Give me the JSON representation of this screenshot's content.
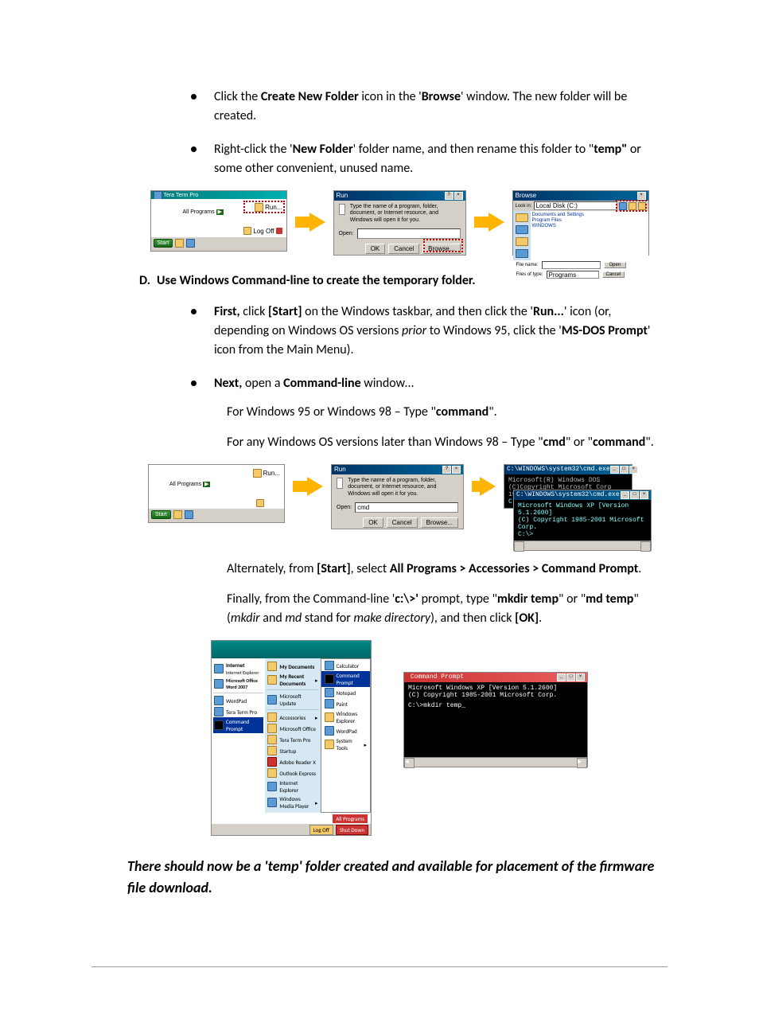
{
  "bullets_c": [
    {
      "pre": "Click the ",
      "b1": "Create New Folder",
      "mid1": " icon in the '",
      "b2": "Browse",
      "mid2": "' window. The new folder will be created."
    },
    {
      "pre": "Right-click the '",
      "b1": "New Folder",
      "mid1": "' folder name, and then rename this folder to \"",
      "b2": "temp\"",
      "mid2": " or some other convenient, unused name."
    }
  ],
  "section_d": {
    "letter": "D.",
    "title": "Use Windows Command-line to create the temporary folder."
  },
  "bullets_d": [
    {
      "first_b": "First,",
      "mid1": " click ",
      "b2": "[Start]",
      "mid2": " on the Windows taskbar, and then click the '",
      "b3": "Run...",
      "mid3": "' icon (or, depending on Windows OS versions ",
      "i1": "prior",
      "mid4": " to Windows 95, click the '",
      "b4": "MS-DOS Prompt",
      "mid5": "' icon from the Main Menu)."
    },
    {
      "first_b": "Next,",
      "mid1": " open a ",
      "b2": "Command-line",
      "mid2": " window…"
    }
  ],
  "indent": {
    "line1a": "For Windows 95 or Windows 98 – Type \"",
    "line1b": "command",
    "line1c": "\".",
    "line2a": "For any Windows OS versions later than Windows 98 – Type \"",
    "line2b": "cmd",
    "line2c": "\" or \"",
    "line2d": "command",
    "line2e": "\".",
    "alt1": "Alternately, from ",
    "alt_b1": "[Start]",
    "alt2": ", select ",
    "alt_b2": "All Programs > Accessories > Command Prompt",
    "alt3": ".",
    "fin1": "Finally, from the Command-line '",
    "fin_b1": "c:\\>'",
    "fin2": " prompt, type \"",
    "fin_b2": "mkdir temp",
    "fin3": "\" or \"",
    "fin_b3": "md temp",
    "fin4": "\" (",
    "fin_i1": "mkdir",
    "fin5": " and ",
    "fin_i2": "md",
    "fin6": " stand for ",
    "fin_i3": "make directory",
    "fin7": "), and then click ",
    "fin_b4": "[OK]",
    "fin8": "."
  },
  "final_note": "There should now be a 'temp' folder created and available for placement of the firmware file download.",
  "fig1": {
    "start": {
      "titleicon": "Tera Term Pro",
      "all_programs": "All Programs",
      "run": "Run...",
      "logoff": "Log Off",
      "start": "Start"
    },
    "run": {
      "title": "Run",
      "desc": "Type the name of a program, folder, document, or Internet resource, and Windows will open it for you.",
      "open": "Open:",
      "ok": "OK",
      "cancel": "Cancel",
      "browse": "Browse...",
      "value": ""
    },
    "browse": {
      "title": "Browse",
      "lookin": "Look in:",
      "drive": "Local Disk (C:)",
      "f1": "Documents and Settings",
      "f2": "Program Files",
      "f3": "WINDOWS",
      "filename_lbl": "File name:",
      "filetype_lbl": "Files of type:",
      "type": "Programs",
      "open": "Open",
      "cancel": "Cancel"
    }
  },
  "fig2": {
    "start": {
      "all_programs": "All Programs",
      "run": "Run...",
      "start": "Start"
    },
    "run": {
      "title": "Run",
      "desc": "Type the name of a program, folder, document, or Internet resource, and Windows will open it for you.",
      "open": "Open:",
      "value": "cmd",
      "ok": "OK",
      "cancel": "Cancel",
      "browse": "Browse..."
    },
    "cmd1": {
      "title": "C:\\WINDOWS\\system32\\cmd.exe",
      "l1": "Microsoft(R) Windows DOS",
      "l2": "(C)Copyright Microsoft Corp 1990-2001.",
      "l3": "C:\\>"
    },
    "cmd2": {
      "title": "C:\\WINDOWS\\system32\\cmd.exe",
      "l1": "Microsoft Windows XP [Version 5.1.2600]",
      "l2": "(C) Copyright 1985-2001 Microsoft Corp.",
      "l3": "C:\\>"
    }
  },
  "fig3": {
    "menu": {
      "internet": "Internet",
      "ie": "Internet Explorer",
      "word": "Microsoft Office Word 2007",
      "mydocs": "My Documents",
      "recent": "My Recent Documents",
      "update": "Microsoft Update",
      "wordpad": "WordPad",
      "ttp": "Tera Term Pro",
      "cp": "Command Prompt",
      "acc": "Accessories",
      "msoffice": "Microsoft Office",
      "teraterm": "Tera Term Pro",
      "startup": "Startup",
      "adober": "Adobe Reader X",
      "outlook": "Outlook Express",
      "iexp": "Internet Explorer",
      "wmp": "Windows Media Player",
      "calc": "Calculator",
      "cmdp": "Command Prompt",
      "notepad": "Notepad",
      "paint": "Paint",
      "winexp": "Windows Explorer",
      "wpad": "WordPad",
      "systools": "System Tools",
      "allprog": "All Programs",
      "logoff": "Log Off",
      "shutdown": "Shut Down"
    },
    "cmd": {
      "title": "Command Prompt",
      "l1": "Microsoft Windows XP [Version 5.1.2600]",
      "l2": "(C) Copyright 1985-2001 Microsoft Corp.",
      "l3": "C:\\>mkdir temp_"
    }
  }
}
